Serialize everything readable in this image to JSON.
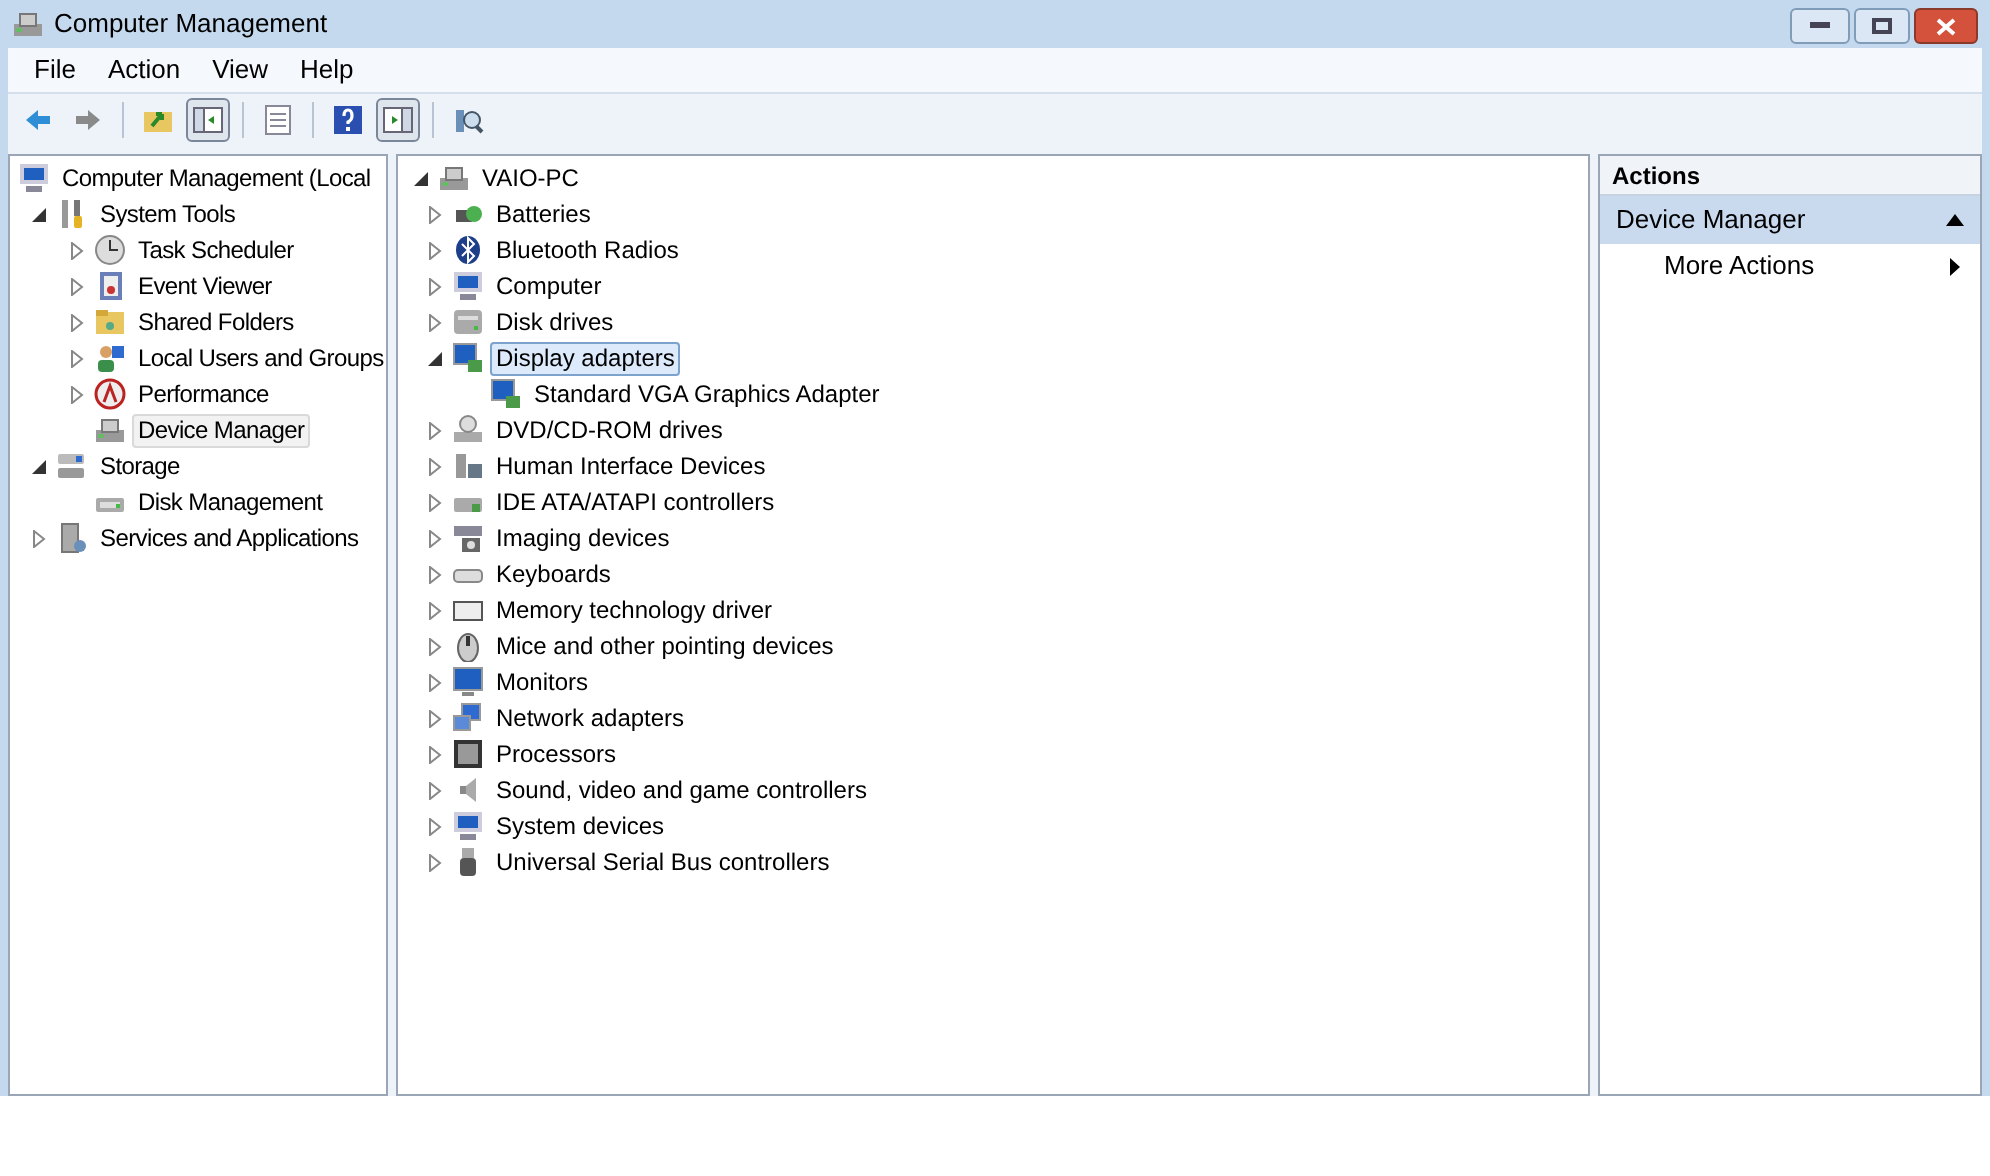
{
  "window": {
    "title": "Computer Management"
  },
  "menu": [
    "File",
    "Action",
    "View",
    "Help"
  ],
  "toolbar": [
    {
      "kind": "button",
      "pressed": false
    },
    {
      "kind": "button",
      "pressed": false
    },
    {
      "kind": "separator"
    },
    {
      "kind": "button",
      "pressed": false
    },
    {
      "kind": "button",
      "pressed": true
    },
    {
      "kind": "separator"
    },
    {
      "kind": "button",
      "pressed": false
    },
    {
      "kind": "separator"
    },
    {
      "kind": "button",
      "pressed": false
    },
    {
      "kind": "button",
      "pressed": true
    },
    {
      "kind": "separator"
    },
    {
      "kind": "button",
      "pressed": false
    }
  ],
  "console_tree": [
    {
      "label": "Computer Management (Local",
      "selected": false,
      "children": [
        {
          "label": "System Tools",
          "selected": false,
          "expanded": true,
          "children": [
            {
              "label": "Task Scheduler",
              "selected": false,
              "expanded": false
            },
            {
              "label": "Event Viewer",
              "selected": false,
              "expanded": false
            },
            {
              "label": "Shared Folders",
              "selected": false,
              "expanded": false
            },
            {
              "label": "Local Users and Groups",
              "selected": false,
              "expanded": false
            },
            {
              "label": "Performance",
              "selected": false,
              "expanded": false
            },
            {
              "label": "Device Manager",
              "selected": true
            }
          ]
        },
        {
          "label": "Storage",
          "selected": false,
          "expanded": true,
          "children": [
            {
              "label": "Disk Management",
              "selected": false
            }
          ]
        },
        {
          "label": "Services and Applications",
          "selected": false,
          "expanded": false
        }
      ]
    }
  ],
  "device_tree": [
    {
      "label": "VAIO-PC",
      "selected": false,
      "expanded": true,
      "children": [
        {
          "label": "Batteries",
          "selected": false,
          "expanded": false
        },
        {
          "label": "Bluetooth Radios",
          "selected": false,
          "expanded": false
        },
        {
          "label": "Computer",
          "selected": false,
          "expanded": false
        },
        {
          "label": "Disk drives",
          "selected": false,
          "expanded": false
        },
        {
          "label": "Display adapters",
          "selected": true,
          "expanded": true,
          "children": [
            {
              "label": "Standard VGA Graphics Adapter",
              "selected": false
            }
          ]
        },
        {
          "label": "DVD/CD-ROM drives",
          "selected": false,
          "expanded": false
        },
        {
          "label": "Human Interface Devices",
          "selected": false,
          "expanded": false
        },
        {
          "label": "IDE ATA/ATAPI controllers",
          "selected": false,
          "expanded": false
        },
        {
          "label": "Imaging devices",
          "selected": false,
          "expanded": false
        },
        {
          "label": "Keyboards",
          "selected": false,
          "expanded": false
        },
        {
          "label": "Memory technology driver",
          "selected": false,
          "expanded": false
        },
        {
          "label": "Mice and other pointing devices",
          "selected": false,
          "expanded": false
        },
        {
          "label": "Monitors",
          "selected": false,
          "expanded": false
        },
        {
          "label": "Network adapters",
          "selected": false,
          "expanded": false
        },
        {
          "label": "Processors",
          "selected": false,
          "expanded": false
        },
        {
          "label": "Sound, video and game controllers",
          "selected": false,
          "expanded": false
        },
        {
          "label": "System devices",
          "selected": false,
          "expanded": false
        },
        {
          "label": "Universal Serial Bus controllers",
          "selected": false,
          "expanded": false
        }
      ]
    }
  ],
  "actions": {
    "title": "Actions",
    "section": {
      "label": "Device Manager",
      "expanded": true
    },
    "items": [
      "More Actions"
    ]
  }
}
